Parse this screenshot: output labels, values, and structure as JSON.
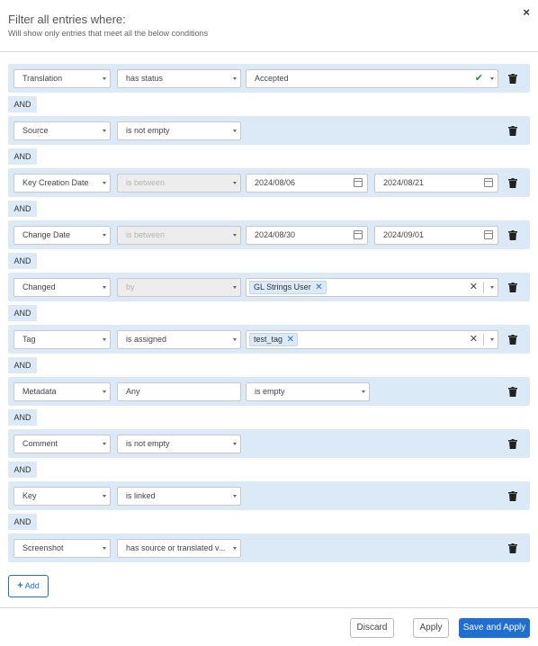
{
  "header": {
    "title": "Filter all entries where:",
    "subtitle": "Will show only entries that meet all the below conditions",
    "close": "×"
  },
  "conjunction": "AND",
  "rows": [
    {
      "field": "Translation",
      "operator": "has status",
      "value": "Accepted",
      "value_icon": "check-icon"
    },
    {
      "field": "Source",
      "operator": "is not empty"
    },
    {
      "field": "Key Creation Date",
      "operator": "is between",
      "date_from": "2024/08/06",
      "date_to": "2024/08/21"
    },
    {
      "field": "Change Date",
      "operator": "is between",
      "date_from": "2024/08/30",
      "date_to": "2024/09/01"
    },
    {
      "field": "Changed",
      "operator": "by",
      "tag": "GL Strings User"
    },
    {
      "field": "Tag",
      "operator": "is assigned",
      "tag": "test_tag"
    },
    {
      "field": "Metadata",
      "operator": "Any",
      "value": "is empty"
    },
    {
      "field": "Comment",
      "operator": "is not empty"
    },
    {
      "field": "Key",
      "operator": "is linked"
    },
    {
      "field": "Screenshot",
      "operator": "has source or translated v..."
    }
  ],
  "add_button": {
    "icon": "plus-icon",
    "label": "Add"
  },
  "footer": {
    "discard": "Discard",
    "apply": "Apply",
    "save_apply": "Save and Apply"
  },
  "colors": {
    "accent": "#1e6fd1",
    "row_bg": "#dceaf8",
    "success": "#2d8a2d"
  }
}
